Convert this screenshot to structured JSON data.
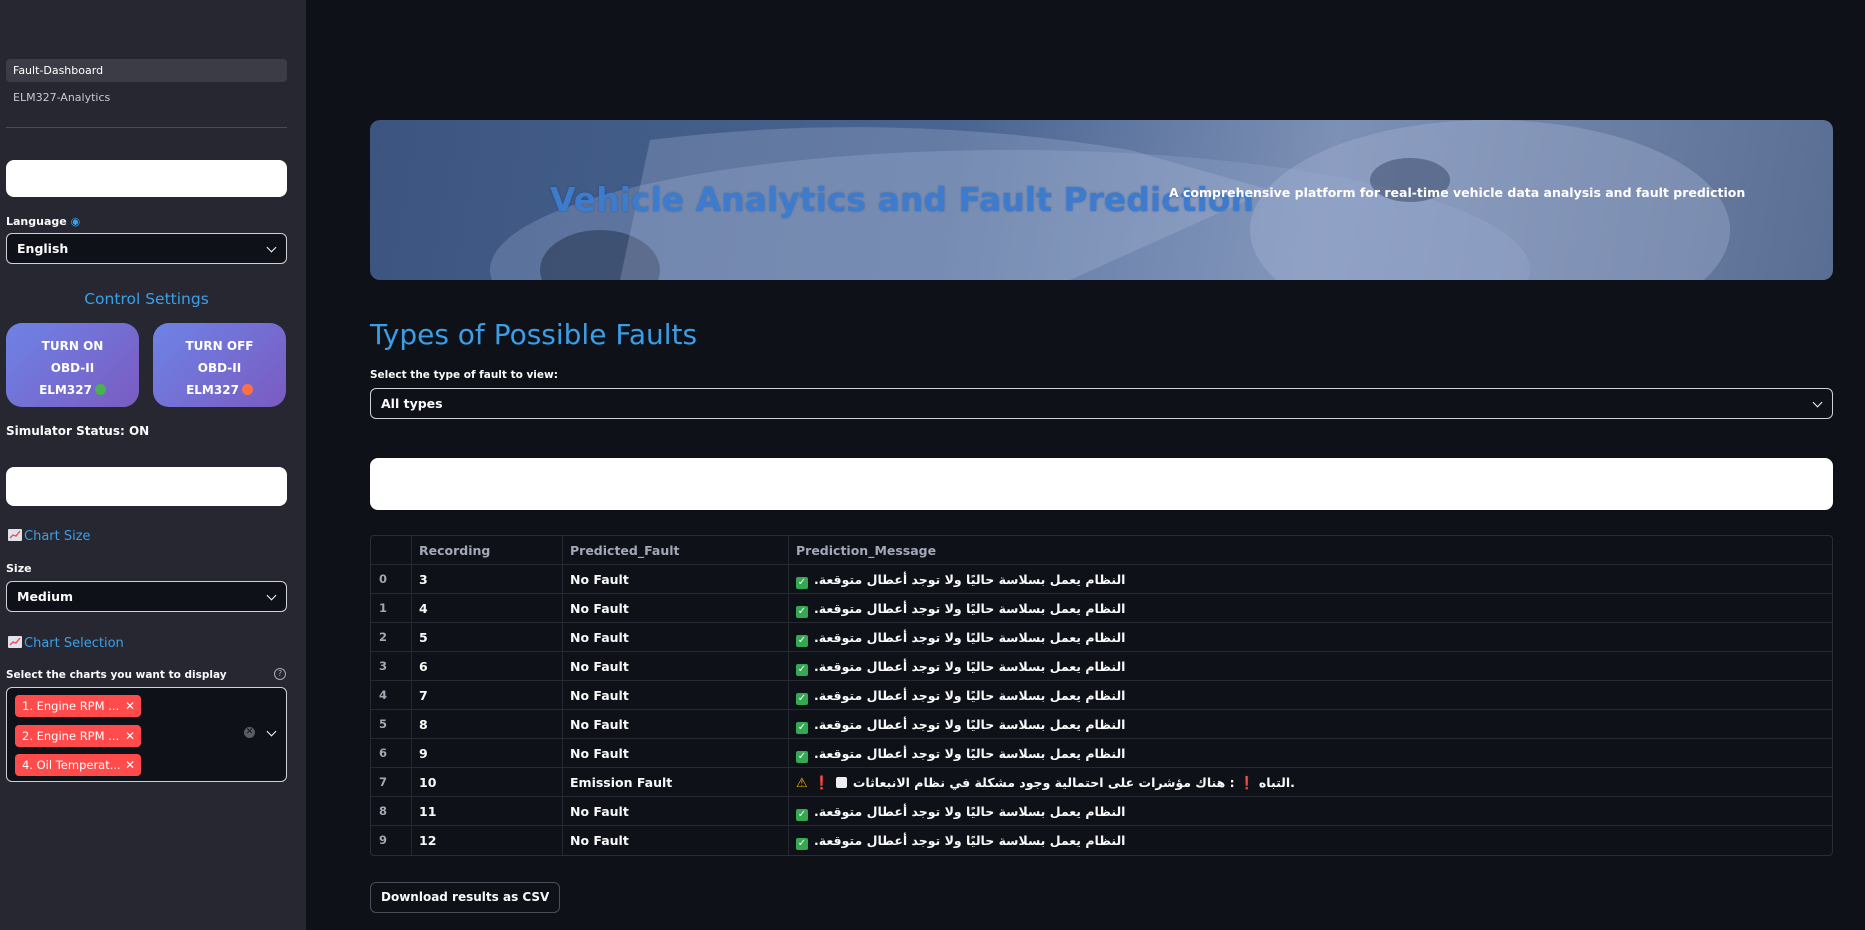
{
  "sidebar": {
    "nav": [
      {
        "label": "Fault-Dashboard",
        "active": true
      },
      {
        "label": "ELM327-Analytics",
        "active": false
      }
    ],
    "language_label": "Language",
    "language_icon": "globe-icon",
    "language_value": "English",
    "control_title": "Control Settings",
    "turn_on": {
      "line1": "TURN ON",
      "line2": "OBD-II",
      "line3": "ELM327",
      "dot_color": "#4caf50"
    },
    "turn_off": {
      "line1": "TURN OFF",
      "line2": "OBD-II",
      "line3": "ELM327",
      "dot_color": "#ff7043"
    },
    "simulator_status": "Simulator Status: ON",
    "chart_size_title": "Chart Size",
    "size_label": "Size",
    "size_value": "Medium",
    "chart_selection_title": "Chart Selection",
    "charts_label": "Select the charts you want to display",
    "selected_charts": [
      "1. Engine RPM ...",
      "2. Engine RPM ...",
      "4. Oil Temperat..."
    ]
  },
  "hero": {
    "title": "Vehicle Analytics and Fault Prediction",
    "subtitle": "A comprehensive platform for real-time vehicle data analysis and fault prediction"
  },
  "main": {
    "title": "Types of Possible Faults",
    "fault_type_label": "Select the type of fault to view:",
    "fault_type_value": "All types",
    "download_label": "Download results as CSV"
  },
  "table": {
    "headers": [
      "",
      "Recording",
      "Predicted_Fault",
      "Prediction_Message"
    ],
    "rows": [
      {
        "idx": "0",
        "recording": "3",
        "fault": "No Fault",
        "message": ".النظام يعمل بسلاسة حاليًا ولا توجد أعطال متوقعة",
        "kind": "ok"
      },
      {
        "idx": "1",
        "recording": "4",
        "fault": "No Fault",
        "message": ".النظام يعمل بسلاسة حاليًا ولا توجد أعطال متوقعة",
        "kind": "ok"
      },
      {
        "idx": "2",
        "recording": "5",
        "fault": "No Fault",
        "message": ".النظام يعمل بسلاسة حاليًا ولا توجد أعطال متوقعة",
        "kind": "ok"
      },
      {
        "idx": "3",
        "recording": "6",
        "fault": "No Fault",
        "message": ".النظام يعمل بسلاسة حاليًا ولا توجد أعطال متوقعة",
        "kind": "ok"
      },
      {
        "idx": "4",
        "recording": "7",
        "fault": "No Fault",
        "message": ".النظام يعمل بسلاسة حاليًا ولا توجد أعطال متوقعة",
        "kind": "ok"
      },
      {
        "idx": "5",
        "recording": "8",
        "fault": "No Fault",
        "message": ".النظام يعمل بسلاسة حاليًا ولا توجد أعطال متوقعة",
        "kind": "ok"
      },
      {
        "idx": "6",
        "recording": "9",
        "fault": "No Fault",
        "message": ".النظام يعمل بسلاسة حاليًا ولا توجد أعطال متوقعة",
        "kind": "ok"
      },
      {
        "idx": "7",
        "recording": "10",
        "fault": "Emission Fault",
        "message": "التباه ❗ : هناك مؤشرات على احتمالية وجود مشكلة في نظام الانبعاثات.",
        "kind": "warn"
      },
      {
        "idx": "8",
        "recording": "11",
        "fault": "No Fault",
        "message": ".النظام يعمل بسلاسة حاليًا ولا توجد أعطال متوقعة",
        "kind": "ok"
      },
      {
        "idx": "9",
        "recording": "12",
        "fault": "No Fault",
        "message": ".النظام يعمل بسلاسة حاليًا ولا توجد أعطال متوقعة",
        "kind": "ok"
      }
    ]
  }
}
